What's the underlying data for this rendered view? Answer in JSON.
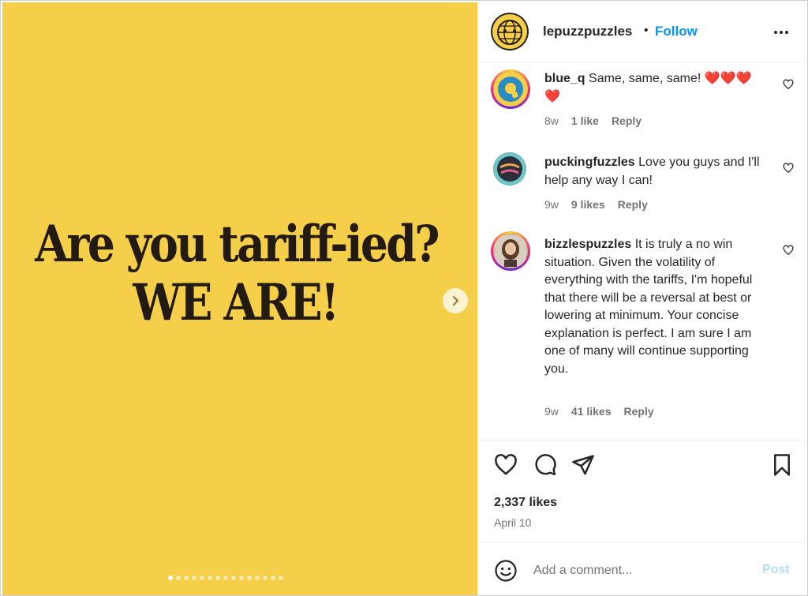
{
  "media": {
    "headline_line1": "Are you tariff-ied?",
    "headline_line2": "WE ARE!",
    "background": "#f5cf49",
    "carousel_count": 15,
    "carousel_active": 1
  },
  "header": {
    "username": "lepuzzpuzzles",
    "separator": "•",
    "follow_label": "Follow",
    "more_icon": "more-horizontal-icon"
  },
  "comments": [
    {
      "username": "blue_q",
      "text": "Same, same, same! ❤️❤️❤️❤️",
      "age": "8w",
      "likes": "1 like",
      "reply": "Reply"
    },
    {
      "username": "puckingfuzzles",
      "text": "Love you guys and I'll help any way I can!",
      "age": "9w",
      "likes": "9 likes",
      "reply": "Reply"
    },
    {
      "username": "bizzlespuzzles",
      "text": "It is truly a no win situation. Given the volatility of everything with the tariffs, I'm hopeful that there will be a reversal at best or lowering at minimum. Your concise explanation is perfect. I am sure I am one of many will continue supporting you.",
      "age": "9w",
      "likes": "41 likes",
      "reply": "Reply"
    }
  ],
  "actions": {
    "likes_count": "2,337 likes",
    "date": "April 10",
    "icons": [
      "heart-icon",
      "comment-icon",
      "share-icon",
      "bookmark-icon"
    ]
  },
  "composer": {
    "placeholder": "Add a comment...",
    "post_label": "Post",
    "post_color": "#b2dffc"
  },
  "colors": {
    "link": "#0095f6",
    "muted": "#737373",
    "text": "#262626"
  }
}
